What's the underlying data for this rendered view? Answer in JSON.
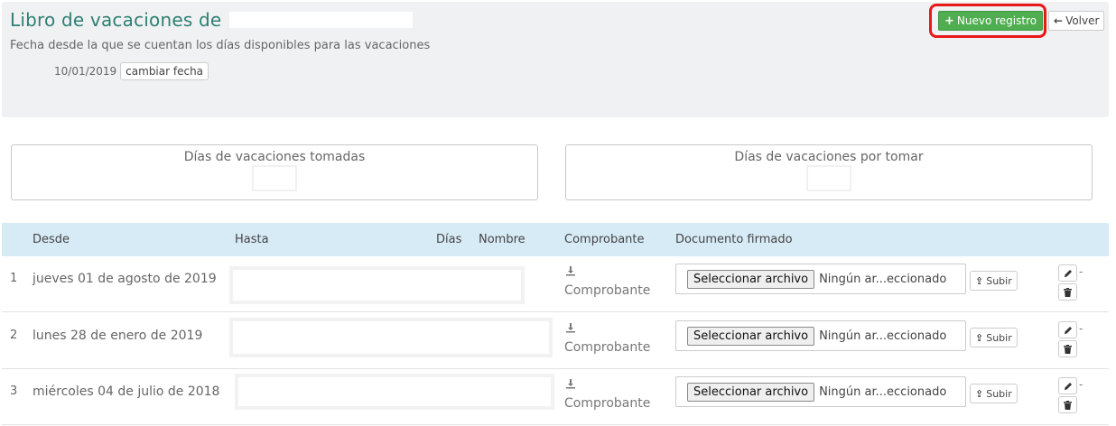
{
  "header": {
    "title": "Libro de vacaciones de",
    "subtitle": "Fecha desde la que se cuentan los días disponibles para las vacaciones",
    "start_date": "10/01/2019",
    "change_date_label": "cambiar fecha",
    "new_record_label": "Nuevo registro",
    "back_label": "Volver",
    "new_record_color": "#4fae4f",
    "highlight_color": "#e81818"
  },
  "summary": {
    "taken_label": "Días de vacaciones tomadas",
    "remaining_label": "Días de vacaciones por tomar"
  },
  "table": {
    "columns": {
      "desde": "Desde",
      "hasta": "Hasta",
      "dias": "Días",
      "nombre": "Nombre",
      "comprobante": "Comprobante",
      "documento": "Documento firmado"
    },
    "header_color": "#d7ebf6",
    "rows": [
      {
        "index": "1",
        "desde": "jueves 01 de agosto de 2019",
        "comprobante": "Comprobante",
        "file_button": "Seleccionar archivo",
        "file_name": "Ningún ar...eccionado",
        "upload_label": "Subir",
        "dash": "-"
      },
      {
        "index": "2",
        "desde": "lunes 28 de enero de 2019",
        "comprobante": "Comprobante",
        "file_button": "Seleccionar archivo",
        "file_name": "Ningún ar...eccionado",
        "upload_label": "Subir",
        "dash": "-"
      },
      {
        "index": "3",
        "desde": "miércoles 04 de julio de 2018",
        "comprobante": "Comprobante",
        "file_button": "Seleccionar archivo",
        "file_name": "Ningún ar...eccionado",
        "upload_label": "Subir",
        "dash": "-"
      }
    ]
  },
  "icons": {
    "download": "download-icon",
    "upload": "upload-icon",
    "edit": "pencil-icon",
    "delete": "trash-icon",
    "plus": "plus-icon",
    "back": "arrow-left-icon"
  }
}
